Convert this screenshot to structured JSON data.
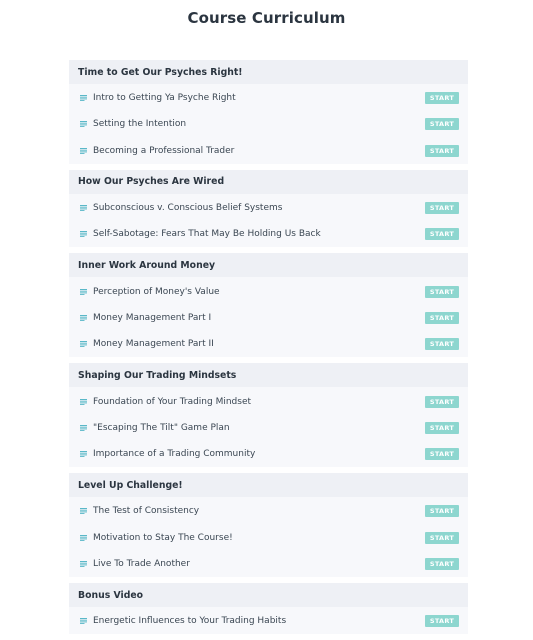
{
  "page": {
    "title": "Course Curriculum"
  },
  "colors": {
    "accent": "#8dd6cf",
    "icon": "#5ab8c8",
    "section_bg": "#eef0f5",
    "row_bg": "#f7f8fb"
  },
  "start_label": "START",
  "lecture_icon": "document-lines-icon",
  "sections": [
    {
      "title": "Time to Get Our Psyches Right!",
      "lectures": [
        {
          "name": "Intro to Getting Ya Psyche Right",
          "button": "START"
        },
        {
          "name": "Setting the Intention",
          "button": "START"
        },
        {
          "name": "Becoming a Professional Trader",
          "button": "START"
        }
      ]
    },
    {
      "title": "How Our Psyches Are Wired",
      "lectures": [
        {
          "name": "Subconscious v. Conscious Belief Systems",
          "button": "START"
        },
        {
          "name": "Self-Sabotage: Fears That May Be Holding Us Back",
          "button": "START"
        }
      ]
    },
    {
      "title": "Inner Work Around Money",
      "lectures": [
        {
          "name": "Perception of Money's Value",
          "button": "START"
        },
        {
          "name": "Money Management Part I",
          "button": "START"
        },
        {
          "name": "Money Management Part II",
          "button": "START"
        }
      ]
    },
    {
      "title": "Shaping Our Trading Mindsets",
      "lectures": [
        {
          "name": "Foundation of Your Trading Mindset",
          "button": "START"
        },
        {
          "name": "\"Escaping The Tilt\" Game Plan",
          "button": "START"
        },
        {
          "name": "Importance of a Trading Community",
          "button": "START"
        }
      ]
    },
    {
      "title": "Level Up Challenge!",
      "lectures": [
        {
          "name": "The Test of Consistency",
          "button": "START"
        },
        {
          "name": "Motivation to Stay The Course!",
          "button": "START"
        },
        {
          "name": "Live To Trade Another",
          "button": "START"
        }
      ]
    },
    {
      "title": "Bonus Video",
      "lectures": [
        {
          "name": "Energetic Influences to Your Trading Habits",
          "button": "START"
        }
      ]
    }
  ]
}
